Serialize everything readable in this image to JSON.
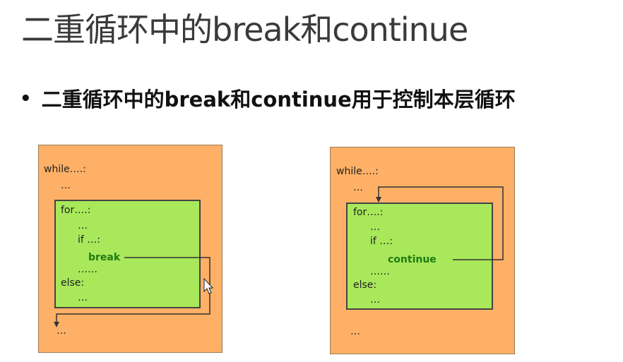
{
  "slide": {
    "title": "二重循环中的break和continue",
    "bullet": "二重循环中的break和continue用于控制本层循环"
  },
  "left_diagram": {
    "while_line": "while….:",
    "dots1": "…",
    "for_line": "for….:",
    "dots2": "…",
    "if_line": "if …:",
    "keyword": "break",
    "dots3": "……",
    "else_line": "else:",
    "dots4": "…",
    "dots5": "…"
  },
  "right_diagram": {
    "while_line": "while….:",
    "dots1": "…",
    "for_line": "for….:",
    "dots2": "…",
    "if_line": "if …:",
    "keyword": "continue",
    "dots3": "……",
    "else_line": "else:",
    "dots4": "…",
    "dots5": "…"
  }
}
